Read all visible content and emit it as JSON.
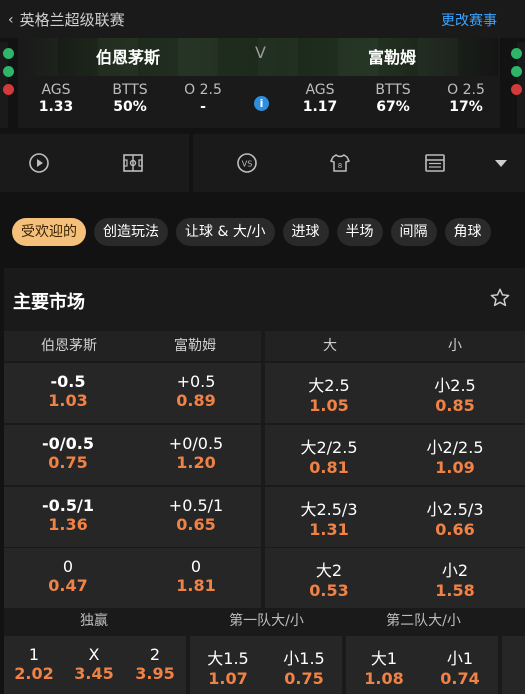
{
  "topbar": {
    "league": "英格兰超级联赛",
    "change_label": "更改赛事"
  },
  "match": {
    "home": "伯恩茅斯",
    "away": "富勒姆",
    "vs": "V",
    "stats_home": [
      {
        "k": "AGS",
        "v": "1.33"
      },
      {
        "k": "BTTS",
        "v": "50%"
      },
      {
        "k": "O 2.5",
        "v": "-"
      }
    ],
    "stats_away": [
      {
        "k": "AGS",
        "v": "1.17"
      },
      {
        "k": "BTTS",
        "v": "67%"
      },
      {
        "k": "O 2.5",
        "v": "17%"
      }
    ],
    "info_glyph": "i"
  },
  "status_dots": {
    "left": [
      "green",
      "green",
      "red"
    ],
    "right": [
      "green",
      "green",
      "red"
    ]
  },
  "tools": {
    "left": [
      "play-icon",
      "pitch-icon"
    ],
    "right": [
      "vs-icon",
      "jersey-icon",
      "scoreboard-icon",
      "dropdown-icon"
    ]
  },
  "pills": [
    "受欢迎的",
    "创造玩法",
    "让球 & 大/小",
    "进球",
    "半场",
    "间隔",
    "角球"
  ],
  "card": {
    "title": "主要市场",
    "headers": [
      "伯恩茅斯",
      "富勒姆",
      "大",
      "小"
    ],
    "rows": [
      [
        {
          "l": "-0.5",
          "o": "1.03"
        },
        {
          "l": "+0.5",
          "o": "0.89"
        },
        {
          "l": "大2.5",
          "o": "1.05"
        },
        {
          "l": "小2.5",
          "o": "0.85"
        }
      ],
      [
        {
          "l": "-0/0.5",
          "o": "0.75"
        },
        {
          "l": "+0/0.5",
          "o": "1.20"
        },
        {
          "l": "大2/2.5",
          "o": "0.81"
        },
        {
          "l": "小2/2.5",
          "o": "1.09"
        }
      ],
      [
        {
          "l": "-0.5/1",
          "o": "1.36"
        },
        {
          "l": "+0.5/1",
          "o": "0.65"
        },
        {
          "l": "大2.5/3",
          "o": "1.31"
        },
        {
          "l": "小2.5/3",
          "o": "0.66"
        }
      ],
      [
        {
          "l": "0",
          "o": "0.47"
        },
        {
          "l": "0",
          "o": "1.81"
        },
        {
          "l": "大2",
          "o": "0.53"
        },
        {
          "l": "小2",
          "o": "1.58"
        }
      ]
    ],
    "sections": [
      "独赢",
      "第一队大/小",
      "第二队大/小"
    ],
    "bottom": [
      {
        "l": "1",
        "o": "2.02"
      },
      {
        "l": "X",
        "o": "3.45"
      },
      {
        "l": "2",
        "o": "3.95"
      },
      {
        "l": "大1.5",
        "o": "1.07"
      },
      {
        "l": "小1.5",
        "o": "0.75"
      },
      {
        "l": "大1",
        "o": "1.08"
      },
      {
        "l": "小1",
        "o": "0.74"
      }
    ]
  },
  "colors": {
    "accent": "#f08246",
    "link": "#3ba3ff",
    "pill_active": "#f5c07a"
  }
}
